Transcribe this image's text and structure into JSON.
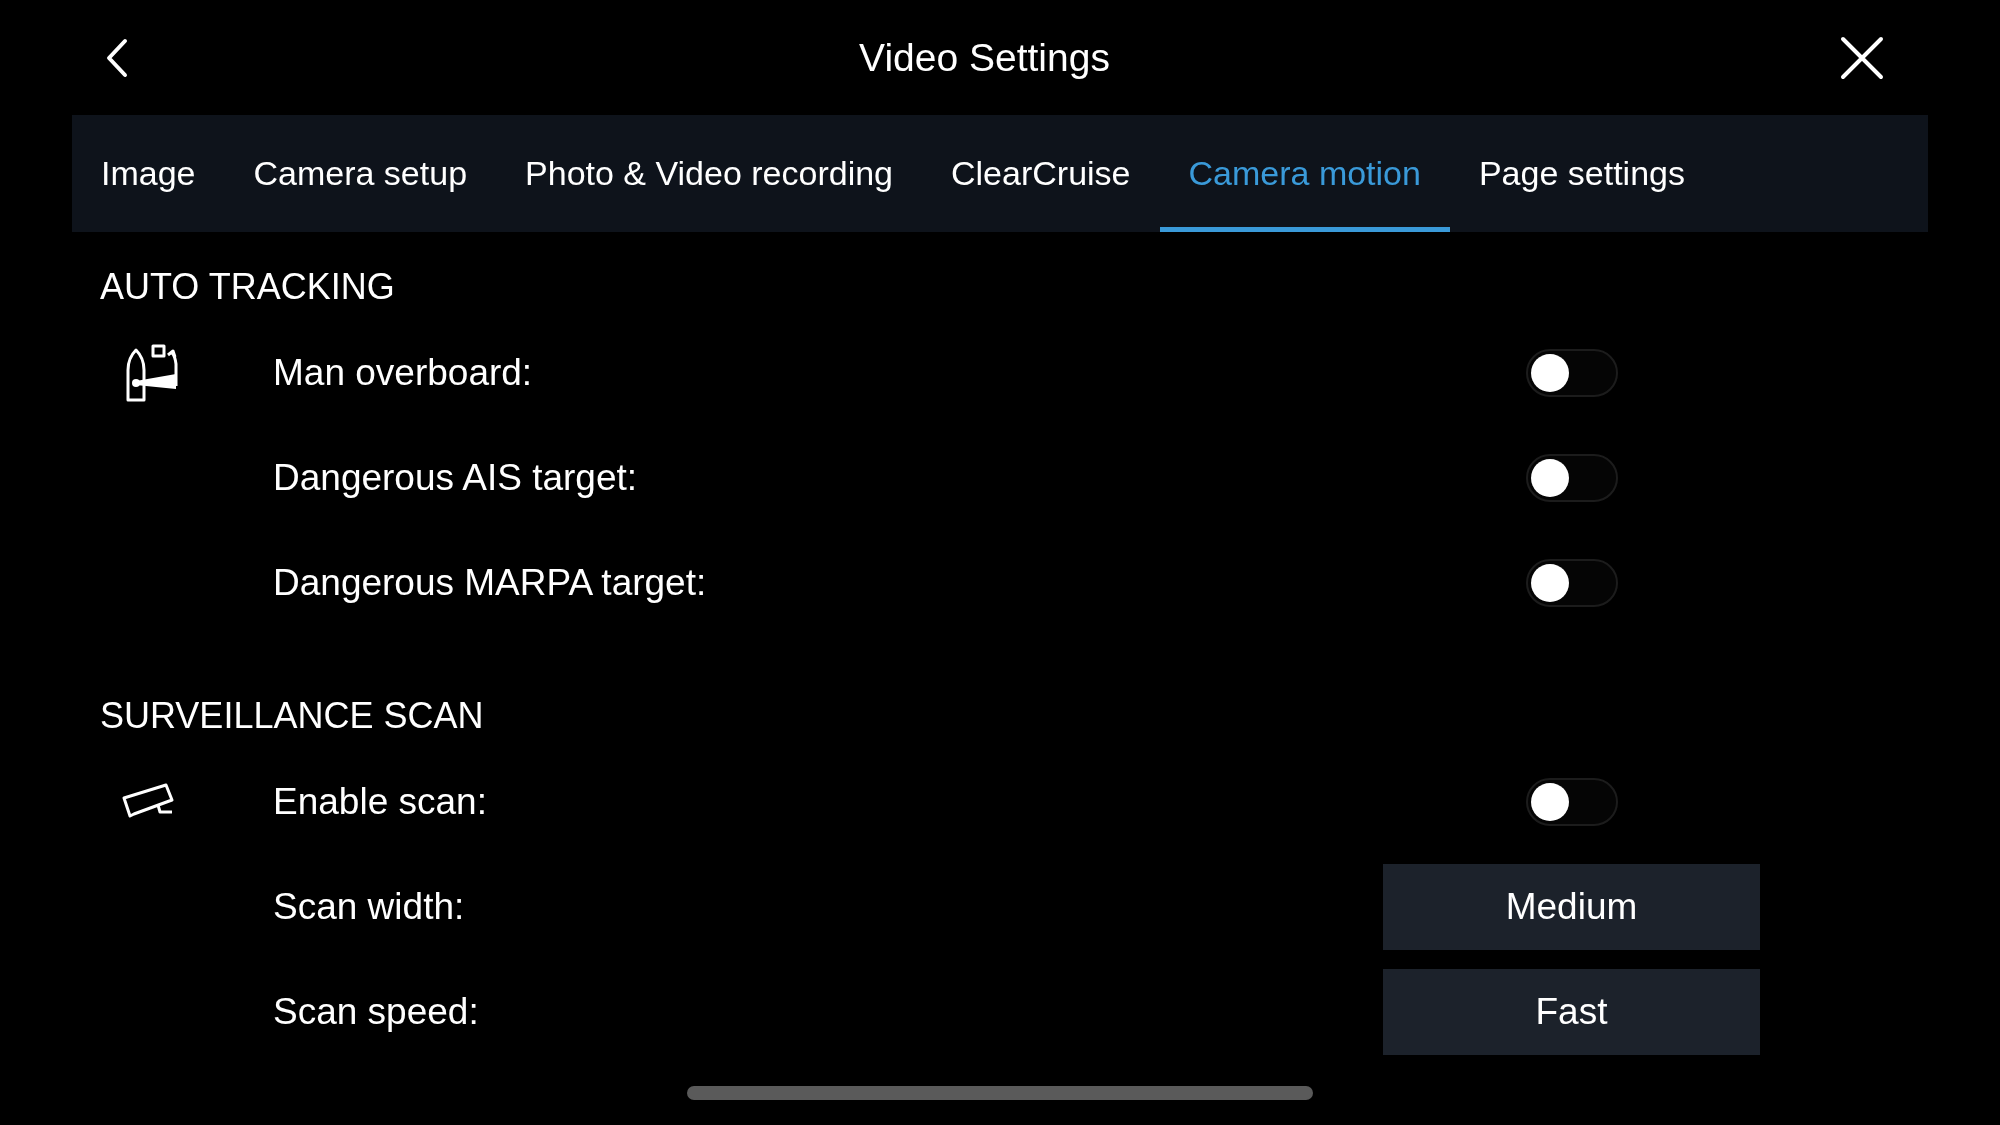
{
  "header": {
    "title": "Video Settings"
  },
  "tabs": [
    {
      "label": "Image",
      "selected": false
    },
    {
      "label": "Camera setup",
      "selected": false
    },
    {
      "label": "Photo & Video recording",
      "selected": false
    },
    {
      "label": "ClearCruise",
      "selected": false
    },
    {
      "label": "Camera motion",
      "selected": true
    },
    {
      "label": "Page settings",
      "selected": false
    }
  ],
  "sections": [
    {
      "title": "AUTO TRACKING",
      "items": [
        {
          "kind": "toggle",
          "label": "Man overboard:",
          "on": false
        },
        {
          "kind": "toggle",
          "label": "Dangerous AIS target:",
          "on": false
        },
        {
          "kind": "toggle",
          "label": "Dangerous MARPA target:",
          "on": false
        }
      ]
    },
    {
      "title": "SURVEILLANCE SCAN",
      "items": [
        {
          "kind": "toggle",
          "label": "Enable scan:",
          "on": false
        },
        {
          "kind": "select",
          "label": "Scan width:",
          "value": "Medium"
        },
        {
          "kind": "select",
          "label": "Scan speed:",
          "value": "Fast"
        }
      ]
    }
  ]
}
